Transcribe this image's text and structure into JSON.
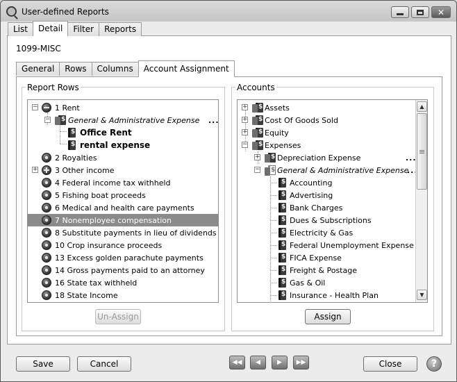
{
  "window": {
    "title": "User-defined Reports",
    "controls": {
      "minimize": "",
      "maximize": "",
      "close": "✕"
    }
  },
  "top_tabs": [
    {
      "label": "List",
      "active": false
    },
    {
      "label": "Detail",
      "active": true
    },
    {
      "label": "Filter",
      "active": false
    },
    {
      "label": "Reports",
      "active": false
    }
  ],
  "report_name": "1099-MISC",
  "sub_tabs": [
    {
      "label": "General",
      "active": false
    },
    {
      "label": "Rows",
      "active": false
    },
    {
      "label": "Columns",
      "active": false
    },
    {
      "label": "Account Assignment",
      "active": true
    }
  ],
  "report_rows": {
    "label": "Report Rows",
    "items": [
      {
        "text": "1 Rent",
        "icon": "disc-minus-icon",
        "expander": "minus"
      },
      {
        "text": "General & Administrative Expense",
        "icon": "account-group-icon",
        "expander": "minus",
        "italic": true,
        "ellipsis": "..."
      },
      {
        "text": "Office Rent",
        "icon": "account-icon",
        "bold": true
      },
      {
        "text": "rental expense",
        "icon": "account-icon",
        "bold": true
      },
      {
        "text": "2 Royalties",
        "icon": "disc-icon"
      },
      {
        "text": "3 Other income",
        "icon": "disc-plus-icon",
        "expander": "plus"
      },
      {
        "text": "4 Federal income tax withheld",
        "icon": "disc-icon"
      },
      {
        "text": "5 Fishing boat proceeds",
        "icon": "disc-icon"
      },
      {
        "text": "6 Medical and health care payments",
        "icon": "disc-icon"
      },
      {
        "text": "7 Nonemployee compensation",
        "icon": "disc-icon",
        "selected": true
      },
      {
        "text": "8 Substitute payments in lieu of dividends",
        "icon": "disc-icon"
      },
      {
        "text": "10 Crop insurance proceeds",
        "icon": "disc-icon"
      },
      {
        "text": "13 Excess golden parachute payments",
        "icon": "disc-icon"
      },
      {
        "text": "14 Gross payments paid to an attorney",
        "icon": "disc-icon"
      },
      {
        "text": "16 State tax withheld",
        "icon": "disc-icon"
      },
      {
        "text": "18 State Income",
        "icon": "disc-icon"
      }
    ],
    "unassign_label": "Un-Assign"
  },
  "accounts": {
    "label": "Accounts",
    "items": [
      {
        "text": "Assets",
        "expander": "plus"
      },
      {
        "text": "Cost Of Goods Sold",
        "expander": "plus"
      },
      {
        "text": "Equity",
        "expander": "plus"
      },
      {
        "text": "Expenses",
        "expander": "minus"
      },
      {
        "text": "Depreciation Expense",
        "expander": "plus",
        "ellipsis": "..."
      },
      {
        "text": "General & Administrative Expense",
        "expander": "minus",
        "italic": true,
        "ellipsis": "..."
      },
      {
        "text": "Accounting"
      },
      {
        "text": "Advertising"
      },
      {
        "text": "Bank Charges"
      },
      {
        "text": "Dues & Subscriptions"
      },
      {
        "text": "Electricity & Gas"
      },
      {
        "text": "Federal Unemployment Expense"
      },
      {
        "text": "FICA Expense"
      },
      {
        "text": "Freight & Postage"
      },
      {
        "text": "Gas & Oil"
      },
      {
        "text": "Insurance - Health Plan"
      }
    ],
    "assign_label": "Assign",
    "scroll": {
      "up": "▲",
      "down": "▼",
      "grip": "≡"
    }
  },
  "footer": {
    "save_label": "Save",
    "cancel_label": "Cancel",
    "close_label": "Close",
    "nav": {
      "first": "◀◀",
      "prev": "◀",
      "next": "▶",
      "last": "▶▶"
    },
    "help": "?"
  }
}
